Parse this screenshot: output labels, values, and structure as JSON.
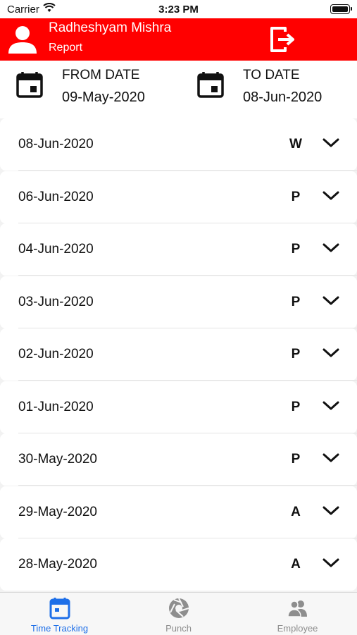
{
  "status_bar": {
    "carrier": "Carrier",
    "time": "3:23 PM"
  },
  "header": {
    "user_name": "Radheshyam Mishra",
    "subtitle": "Report",
    "background_color": "#ff0000",
    "avatar_icon": "user-avatar-icon",
    "logout_icon": "logout-icon"
  },
  "dates": {
    "from_label": "FROM DATE",
    "from_value": "09-May-2020",
    "to_label": "TO DATE",
    "to_value": "08-Jun-2020",
    "icon": "calendar-icon"
  },
  "records": [
    {
      "date": "08-Jun-2020",
      "status": "W"
    },
    {
      "date": "06-Jun-2020",
      "status": "P"
    },
    {
      "date": "04-Jun-2020",
      "status": "P"
    },
    {
      "date": "03-Jun-2020",
      "status": "P"
    },
    {
      "date": "02-Jun-2020",
      "status": "P"
    },
    {
      "date": "01-Jun-2020",
      "status": "P"
    },
    {
      "date": "30-May-2020",
      "status": "P"
    },
    {
      "date": "29-May-2020",
      "status": "A"
    },
    {
      "date": "28-May-2020",
      "status": "A"
    }
  ],
  "tabs": [
    {
      "label": "Time Tracking",
      "icon": "calendar-icon",
      "active": true
    },
    {
      "label": "Punch",
      "icon": "camera-aperture-icon",
      "active": false
    },
    {
      "label": "Employee",
      "icon": "people-icon",
      "active": false
    }
  ],
  "colors": {
    "accent": "#1e6fe8",
    "inactive": "#8e8e8e"
  }
}
